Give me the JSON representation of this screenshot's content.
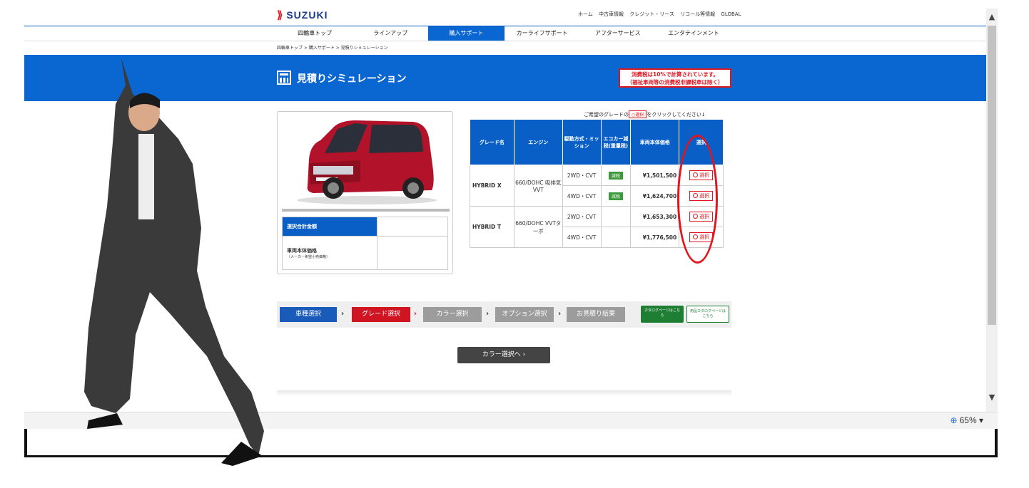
{
  "header": {
    "logo_text": "SUZUKI",
    "top_links": [
      "ホーム",
      "中古車情報",
      "クレジット・リース",
      "リコール等情報",
      "GLOBAL"
    ]
  },
  "nav": {
    "items": [
      "四輪車トップ",
      "ラインアップ",
      "購入サポート",
      "カーライフサポート",
      "アフターサービス",
      "エンタテインメント"
    ],
    "active_index": 2
  },
  "breadcrumb": "四輪車トップ > 購入サポート > 見積りシミュレーション",
  "banner": {
    "title": "見積りシミュレーション",
    "tax_note_line1": "消費税は10%で計算されています。",
    "tax_note_line2": "（福祉車両等の消費税非課税車は除く）"
  },
  "summary": {
    "total_label": "選択合計金額",
    "body_price_label": "車両本体価格",
    "body_price_sub": "（メーカー希望小売価格）"
  },
  "grade_table": {
    "hint_prefix": "ご希望のグレードの",
    "hint_button": "○選択",
    "hint_suffix": "をクリックしてください↓",
    "headers": [
      "グレード名",
      "エンジン",
      "駆動方式・ミッション",
      "エコカー減税(重量税)",
      "車両本体価格",
      "選択"
    ],
    "groups": [
      {
        "name": "HYBRID X",
        "engine": "660/DOHC 吸排気VVT",
        "rows": [
          {
            "drive": "2WD・CVT",
            "eco": "減税",
            "price": "¥1,501,500",
            "select": "選択"
          },
          {
            "drive": "4WD・CVT",
            "eco": "減税",
            "price": "¥1,624,700",
            "select": "選択"
          }
        ]
      },
      {
        "name": "HYBRID T",
        "engine": "660/DOHC VVTターボ",
        "rows": [
          {
            "drive": "2WD・CVT",
            "eco": "",
            "price": "¥1,653,300",
            "select": "選択"
          },
          {
            "drive": "4WD・CVT",
            "eco": "",
            "price": "¥1,776,500",
            "select": "選択"
          }
        ]
      }
    ]
  },
  "steps": [
    "車種選択",
    "グレード選択",
    "カラー選択",
    "オプション選択",
    "お見積り結果"
  ],
  "catalog_buttons": [
    "カタログページはこちら",
    "用品カタログページはこちら"
  ],
  "next_button": "カラー選択へ",
  "status": {
    "zoom": "65%"
  },
  "colors": {
    "brand_blue": "#0a66d0",
    "accent_red": "#e0161f",
    "eco_green": "#3b9a3b"
  }
}
